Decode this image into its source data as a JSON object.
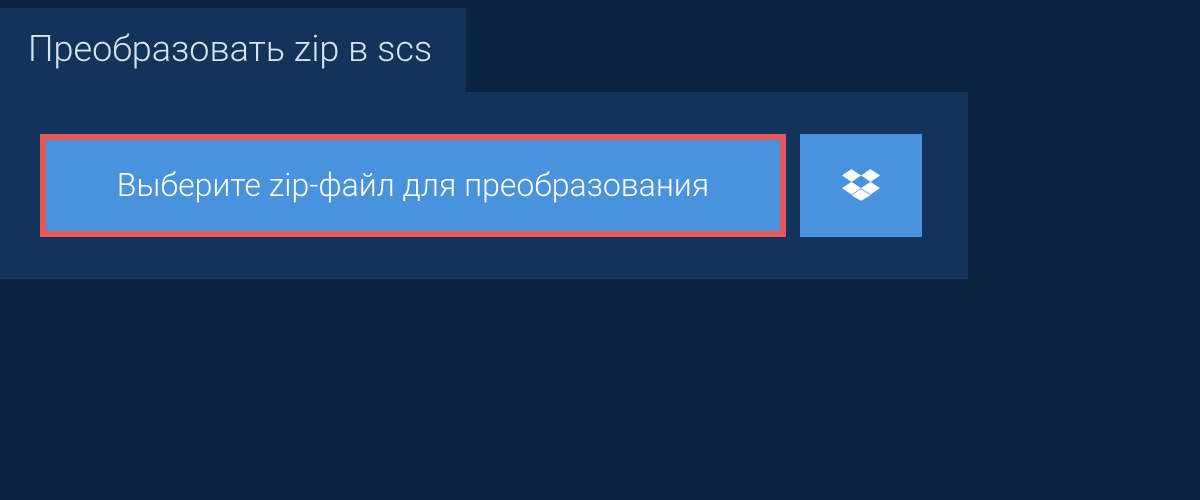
{
  "header": {
    "tab_label": "Преобразовать zip в scs"
  },
  "actions": {
    "select_file_label": "Выберите zip-файл для преобразования"
  },
  "colors": {
    "background": "#0a2440",
    "panel": "#12335a",
    "button": "#4993de",
    "highlight_border": "#e45a58"
  }
}
